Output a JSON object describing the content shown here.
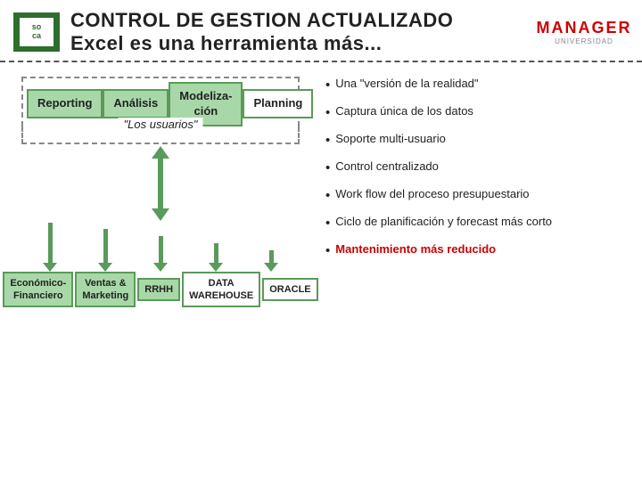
{
  "header": {
    "logo_line1": "so",
    "logo_line2": "ca",
    "title1": "CONTROL DE GESTION ACTUALIZADO",
    "title2": "Excel es una herramienta más...",
    "manager_label": "MANAGER",
    "manager_sub": "UNIVERSIDAD"
  },
  "left": {
    "box_reporting": "Reporting",
    "box_analisis": "Análisis",
    "box_modelizacion_line1": "Modeliza-",
    "box_modelizacion_line2": "ción",
    "box_planning": "Planning",
    "usuarios_label": "\"Los usuarios\"",
    "bottom_box1_line1": "Económico-",
    "bottom_box1_line2": "Financiero",
    "bottom_box2_line1": "Ventas &",
    "bottom_box2_line2": "Marketing",
    "bottom_box3": "RRHH",
    "bottom_box4_line1": "DATA",
    "bottom_box4_line2": "WAREHOUSE",
    "bottom_box5": "ORACLE"
  },
  "bullets": [
    {
      "id": "b1",
      "text": "Una \"versión de la realidad\"",
      "highlight": false
    },
    {
      "id": "b2",
      "text": "Captura única de los datos",
      "highlight": false
    },
    {
      "id": "b3",
      "text": "Soporte multi-usuario",
      "highlight": false
    },
    {
      "id": "b4",
      "text": "Control centralizado",
      "highlight": false
    },
    {
      "id": "b5",
      "text": "Work flow del proceso presupuestario",
      "highlight": false
    },
    {
      "id": "b6",
      "text": "Ciclo de planificación y forecast más corto",
      "highlight": false
    },
    {
      "id": "b7",
      "text": "Mantenimiento más reducido",
      "highlight": true
    }
  ]
}
